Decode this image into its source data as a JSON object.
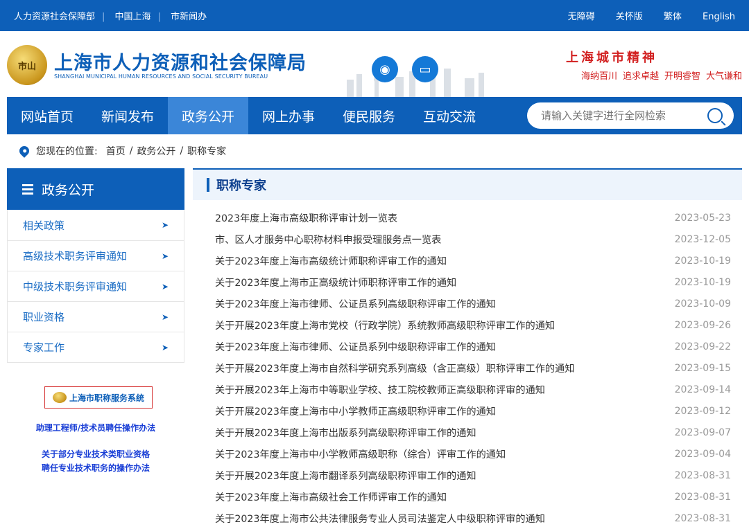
{
  "topbar": {
    "links": [
      "人力资源社会保障部",
      "中国上海",
      "市新闻办"
    ],
    "right": [
      "无障碍",
      "关怀版",
      "繁体",
      "English"
    ]
  },
  "header": {
    "emblem_text": "市山",
    "title": "上海市人力资源和社会保障局",
    "subtitle": "SHANGHAI MUNICIPAL HUMAN RESOURCES AND SOCIAL SECURITY BUREAU",
    "spirit_title": "上海城市精神",
    "spirit_words": [
      "海纳百川",
      "追求卓越",
      "开明睿智",
      "大气谦和"
    ]
  },
  "nav": {
    "items": [
      "网站首页",
      "新闻发布",
      "政务公开",
      "网上办事",
      "便民服务",
      "互动交流"
    ],
    "active_index": 2,
    "search_placeholder": "请输入关键字进行全网检索"
  },
  "breadcrumb": {
    "label": "您现在的位置:",
    "items": [
      "首页",
      "政务公开",
      "职称专家"
    ]
  },
  "sidebar": {
    "title": "政务公开",
    "items": [
      "相关政策",
      "高级技术职务评审通知",
      "中级技术职务评审通知",
      "职业资格",
      "专家工作"
    ],
    "badge": "上海市职称服务系统",
    "link1": "助理工程师/技术员聘任操作办法",
    "link2_line1": "关于部分专业技术类职业资格",
    "link2_line2": "聘任专业技术职务的操作办法"
  },
  "main": {
    "title": "职称专家",
    "rows": [
      {
        "title": "2023年度上海市高级职称评审计划一览表",
        "date": "2023-05-23"
      },
      {
        "title": "市、区人才服务中心职称材料申报受理服务点一览表",
        "date": "2023-12-05"
      },
      {
        "title": "关于2023年度上海市高级统计师职称评审工作的通知",
        "date": "2023-10-19"
      },
      {
        "title": "关于2023年度上海市正高级统计师职称评审工作的通知",
        "date": "2023-10-19"
      },
      {
        "title": "关于2023年度上海市律师、公证员系列高级职称评审工作的通知",
        "date": "2023-10-09"
      },
      {
        "title": "关于开展2023年度上海市党校（行政学院）系统教师高级职称评审工作的通知",
        "date": "2023-09-26"
      },
      {
        "title": "关于2023年度上海市律师、公证员系列中级职称评审工作的通知",
        "date": "2023-09-22"
      },
      {
        "title": "关于开展2023年度上海市自然科学研究系列高级（含正高级）职称评审工作的通知",
        "date": "2023-09-15"
      },
      {
        "title": "关于开展2023年上海市中等职业学校、技工院校教师正高级职称评审的通知",
        "date": "2023-09-14"
      },
      {
        "title": "关于开展2023年度上海市中小学教师正高级职称评审工作的通知",
        "date": "2023-09-12"
      },
      {
        "title": "关于开展2023年度上海市出版系列高级职称评审工作的通知",
        "date": "2023-09-07"
      },
      {
        "title": "关于2023年度上海市中小学教师高级职称（综合）评审工作的通知",
        "date": "2023-09-04"
      },
      {
        "title": "关于开展2023年度上海市翻译系列高级职称评审工作的通知",
        "date": "2023-08-31"
      },
      {
        "title": "关于2023年度上海市高级社会工作师评审工作的通知",
        "date": "2023-08-31"
      },
      {
        "title": "关于2023年度上海市公共法律服务专业人员司法鉴定人中级职称评审的通知",
        "date": "2023-08-31"
      }
    ]
  },
  "colors": {
    "brand": "#0d5fb8",
    "active_nav": "#3b86d8",
    "spirit_red": "#d22020"
  }
}
